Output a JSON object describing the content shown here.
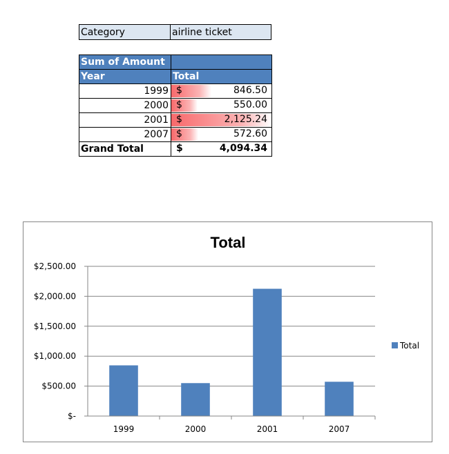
{
  "filter": {
    "label": "Category",
    "value": "airline ticket"
  },
  "pivot": {
    "header_label": "Sum of Amount",
    "row_header": "Year",
    "col_header": "Total",
    "currency_symbol": "$",
    "rows": [
      {
        "year": "1999",
        "amount": "846.50"
      },
      {
        "year": "2000",
        "amount": "550.00"
      },
      {
        "year": "2001",
        "amount": "2,125.24"
      },
      {
        "year": "2007",
        "amount": "572.60"
      }
    ],
    "grand_total_label": "Grand Total",
    "grand_total": "4,094.34"
  },
  "colors": {
    "header_blue": "#4f81bd",
    "filter_fill": "#dce6f1",
    "bar": "#4f81bd",
    "data_bar": "#f8696b",
    "gridline": "#868686"
  },
  "chart_data": {
    "type": "bar",
    "title": "Total",
    "categories": [
      "1999",
      "2000",
      "2001",
      "2007"
    ],
    "series": [
      {
        "name": "Total",
        "values": [
          846.5,
          550.0,
          2125.24,
          572.6
        ]
      }
    ],
    "ylim": [
      0,
      2500
    ],
    "yticks": [
      0,
      500,
      1000,
      1500,
      2000,
      2500
    ],
    "ytick_labels": [
      "$-",
      "$500.00",
      "$1,000.00",
      "$1,500.00",
      "$2,000.00",
      "$2,500.00"
    ],
    "grid": true,
    "legend": "right"
  }
}
